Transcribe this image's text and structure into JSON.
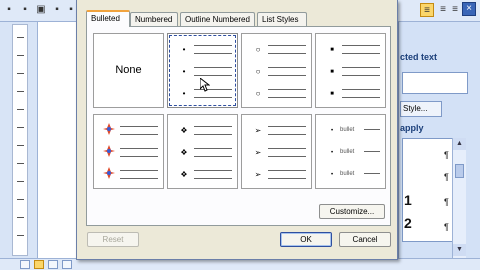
{
  "dialog": {
    "tabs": [
      {
        "label": "Bulleted"
      },
      {
        "label": "Numbered"
      },
      {
        "label": "Outline Numbered"
      },
      {
        "label": "List Styles"
      }
    ],
    "none_label": "None",
    "bullet_text": "bullet",
    "bullet_glyphs": {
      "dot": "•",
      "circle": "○",
      "square": "■",
      "diamond4": "❖",
      "arrow": "➢",
      "small": "•"
    },
    "customize_label": "Customize...",
    "reset_label": "Reset",
    "ok_label": "OK",
    "cancel_label": "Cancel"
  },
  "pane": {
    "title": "cted text",
    "style_button": "Style...",
    "apply_label": "apply",
    "numbers": [
      "1",
      "2"
    ],
    "para_mark": "¶"
  },
  "colors": {
    "dialog_bg": "#ece9d8",
    "tab_accent": "#f1a33e",
    "pane_bg": "#d3e1f6",
    "selected_tool": "#fbd66a"
  }
}
